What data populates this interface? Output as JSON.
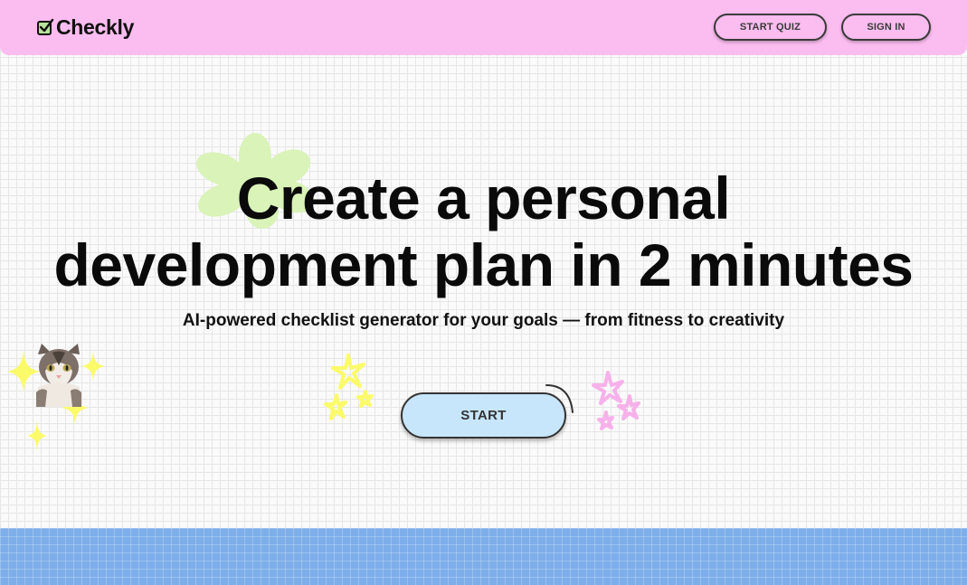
{
  "brand": {
    "name": "Checkly",
    "logo_icon": "checkbox-icon",
    "header_color": "#fbbcf0"
  },
  "nav": {
    "start_quiz_label": "START QUIZ",
    "sign_in_label": "SIGN IN"
  },
  "hero": {
    "headline_line1": "Create a personal",
    "headline_line2": "development plan in 2 minutes",
    "subtitle": "AI-powered checklist generator for your goals — from fitness to creativity",
    "start_label": "START",
    "start_button_color": "#c8e6fb"
  },
  "decorations": {
    "flower_color": "#d9f3b8",
    "sparkle_yellow": "#fbfb6a",
    "sparkle_pink": "#f7b1ea",
    "band_color": "#7eaeea",
    "icons": [
      "flower-icon",
      "cat-sticker",
      "sparkle-icon",
      "swoosh-icon"
    ]
  }
}
